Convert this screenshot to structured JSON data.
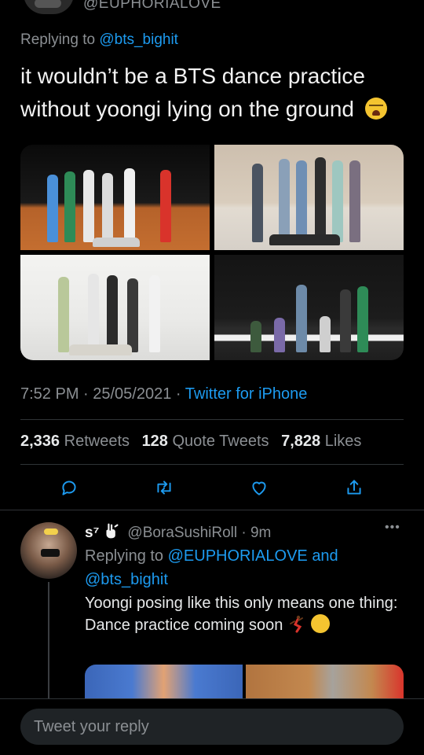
{
  "original_tweet": {
    "handle": "@EUPHORIALOVE",
    "replying_prefix": "Replying to",
    "replying_to": "@bts_bighit",
    "text": "it wouldn’t be a BTS dance practice without yoongi lying on the ground",
    "emoji": "loudly-crying-face",
    "timestamp": "7:52 PM · 25/05/2021 · ",
    "source": "Twitter for iPhone",
    "stats": {
      "retweets_count": "2,336",
      "retweets_label": "Retweets",
      "quotes_count": "128",
      "quotes_label": "Quote Tweets",
      "likes_count": "7,828",
      "likes_label": "Likes"
    },
    "actions": [
      "reply-icon",
      "retweet-icon",
      "like-icon",
      "share-icon"
    ]
  },
  "reply": {
    "name": "s⁷",
    "handle_time": "@BoraSushiRoll · 9m",
    "more": "•••",
    "replying_prefix": "Replying to",
    "replying_to_1": "@EUPHORIALOVE",
    "and": "and",
    "replying_to_2": "@bts_bighit",
    "text_line_1": "Yoongi posing like this only means one thing:",
    "text_line_2": "Dance practice coming soon"
  },
  "composer": {
    "placeholder": "Tweet your reply"
  },
  "colors": {
    "accent": "#1d9bf0",
    "background": "#000000",
    "muted": "#8b8f93",
    "divider": "#2f3336"
  }
}
